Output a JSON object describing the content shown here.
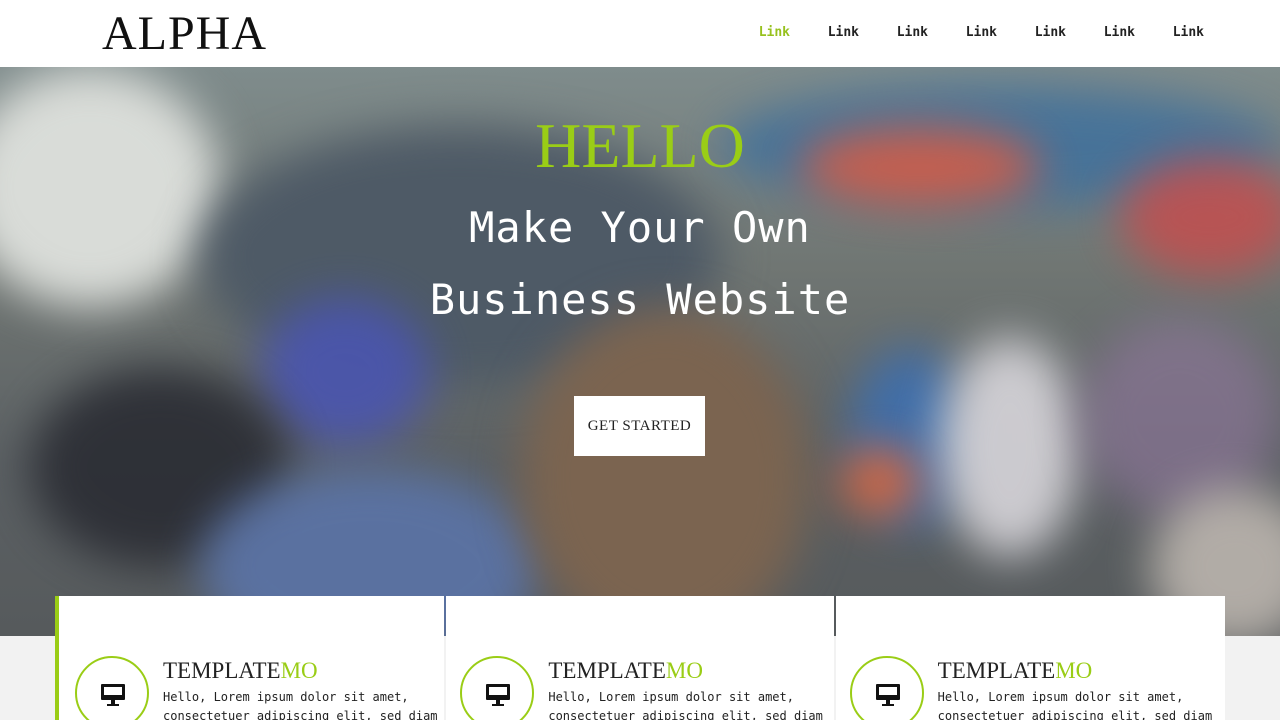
{
  "header": {
    "logo": "ALPHA",
    "nav": [
      "Link",
      "Link",
      "Link",
      "Link",
      "Link",
      "Link",
      "Link"
    ],
    "active_index": 0
  },
  "hero": {
    "hello": "HELLO",
    "tagline_line1": "Make Your Own",
    "tagline_line2": "Business Website",
    "cta_label": "GET STARTED"
  },
  "cards": [
    {
      "icon": "monitor-icon",
      "title_main": "TEMPLATE",
      "title_accent": "MO",
      "text_line1": "Hello, Lorem ipsum dolor sit amet,",
      "text_line2": "consectetuer adipiscing elit, sed diam"
    },
    {
      "icon": "monitor-icon",
      "title_main": "TEMPLATE",
      "title_accent": "MO",
      "text_line1": "Hello, Lorem ipsum dolor sit amet,",
      "text_line2": "consectetuer adipiscing elit, sed diam"
    },
    {
      "icon": "monitor-icon",
      "title_main": "TEMPLATE",
      "title_accent": "MO",
      "text_line1": "Hello, Lorem ipsum dolor sit amet,",
      "text_line2": "consectetuer adipiscing elit, sed diam"
    }
  ],
  "colors": {
    "accent": "#9acd16",
    "header_bg": "#ffffff",
    "text": "#222222"
  }
}
